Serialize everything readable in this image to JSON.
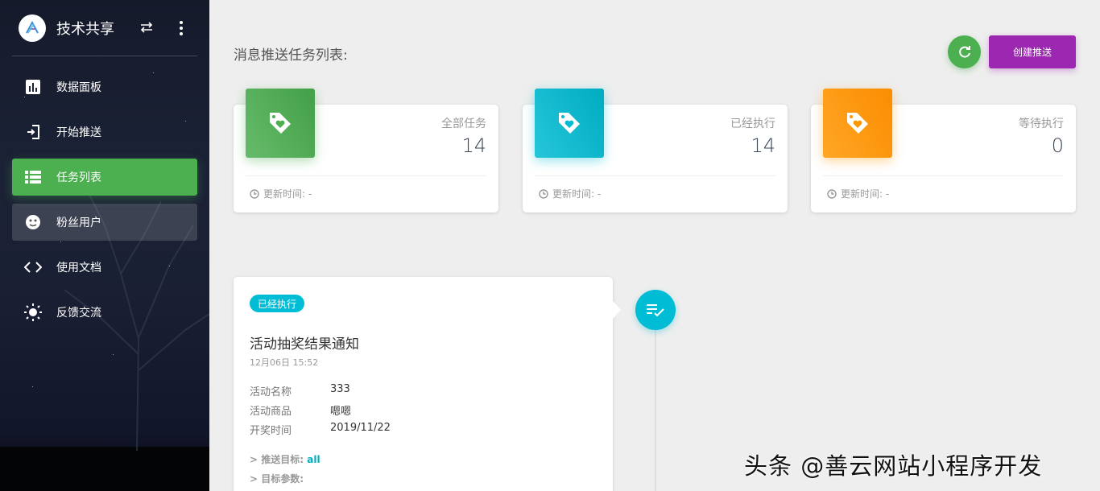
{
  "app": {
    "brand_title": "技术共享"
  },
  "sidebar": {
    "items": [
      {
        "label": "数据面板",
        "icon": "bar-chart-icon"
      },
      {
        "label": "开始推送",
        "icon": "login-icon"
      },
      {
        "label": "任务列表",
        "icon": "list-icon",
        "state": "active"
      },
      {
        "label": "粉丝用户",
        "icon": "face-icon",
        "state": "hover"
      },
      {
        "label": "使用文档",
        "icon": "code-icon"
      },
      {
        "label": "反馈交流",
        "icon": "sun-icon"
      }
    ]
  },
  "header": {
    "title": "消息推送任务列表:",
    "create_label": "创建推送"
  },
  "stats": [
    {
      "category": "全部任务",
      "value": "14",
      "footer": "更新时间: -",
      "color": "#4caf50"
    },
    {
      "category": "已经执行",
      "value": "14",
      "footer": "更新时间: -",
      "color": "#00bcd4"
    },
    {
      "category": "等待执行",
      "value": "0",
      "footer": "更新时间: -",
      "color": "#ff9800"
    }
  ],
  "task": {
    "status": "已经执行",
    "title": "活动抽奖结果通知",
    "time": "12月06日 15:52",
    "fields": [
      {
        "key": "活动名称",
        "value": "333"
      },
      {
        "key": "活动商品",
        "value": "嗯嗯"
      },
      {
        "key": "开奖时间",
        "value": "2019/11/22"
      }
    ],
    "target_label": "> 推送目标:",
    "target_value": "all",
    "params_label": "> 目标参数:"
  },
  "colors": {
    "success": "#4caf50",
    "info": "#00bcd4",
    "warning": "#ff9800",
    "primary": "#9c27b0"
  },
  "watermark": "头条 @善云网站小程序开发"
}
